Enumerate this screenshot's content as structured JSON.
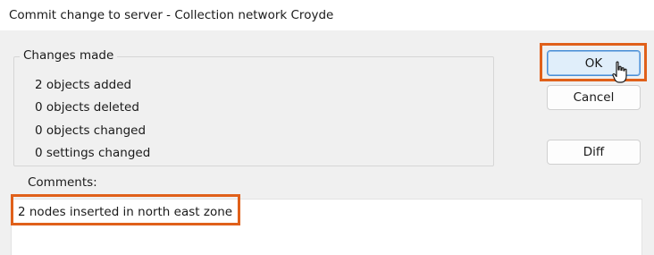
{
  "window": {
    "title": "Commit change to server - Collection network Croyde"
  },
  "changes": {
    "group_label": "Changes made",
    "lines": [
      "2 objects added",
      "0 objects deleted",
      "0 objects changed",
      "0 settings changed"
    ]
  },
  "buttons": {
    "ok_label": "OK",
    "cancel_label": "Cancel",
    "diff_label": "Diff"
  },
  "comments": {
    "label": "Comments:",
    "value": "2 nodes inserted in north east zone"
  },
  "colors": {
    "highlight": "#e0601a",
    "focus_button": "#4a8fd6",
    "dialog_background": "#f0f0f0"
  },
  "icons": {
    "cursor": "hand-pointer-icon"
  }
}
